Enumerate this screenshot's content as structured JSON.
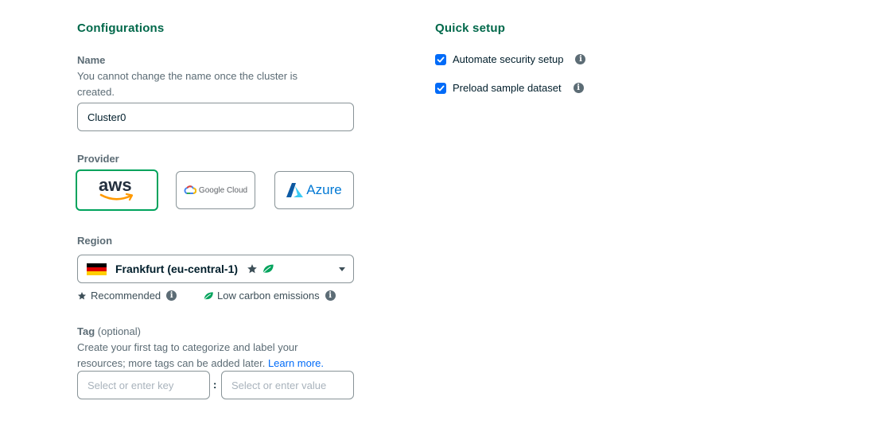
{
  "configurations": {
    "title": "Configurations",
    "name": {
      "label": "Name",
      "description_line1": "You cannot change the name once the cluster is",
      "description_line2": "created.",
      "value": "Cluster0"
    },
    "provider": {
      "label": "Provider",
      "options": [
        {
          "id": "aws",
          "text": "aws",
          "selected": true
        },
        {
          "id": "gcp",
          "text": "Google Cloud",
          "selected": false
        },
        {
          "id": "azure",
          "text": "Azure",
          "selected": false
        }
      ]
    },
    "region": {
      "label": "Region",
      "selected": "Frankfurt (eu-central-1)",
      "flag_colors": [
        "#000000",
        "#dd0000",
        "#ffce00"
      ],
      "legend": {
        "recommended": "Recommended",
        "low_carbon": "Low carbon emissions"
      }
    },
    "tag": {
      "label": "Tag",
      "optional": "(optional)",
      "description_line1": "Create your first tag to categorize and label your",
      "description_line2": "resources; more tags can be added later.",
      "learn_more": "Learn more.",
      "key_placeholder": "Select or enter key",
      "separator": ":",
      "value_placeholder": "Select or enter value"
    }
  },
  "quick_setup": {
    "title": "Quick setup",
    "options": [
      {
        "label": "Automate security setup",
        "checked": true
      },
      {
        "label": "Preload sample dataset",
        "checked": true
      }
    ]
  },
  "colors": {
    "accent_green": "#00684a",
    "selected_border": "#00a35c",
    "checkbox_blue": "#016bf8",
    "leaf_green": "#00a35c"
  }
}
